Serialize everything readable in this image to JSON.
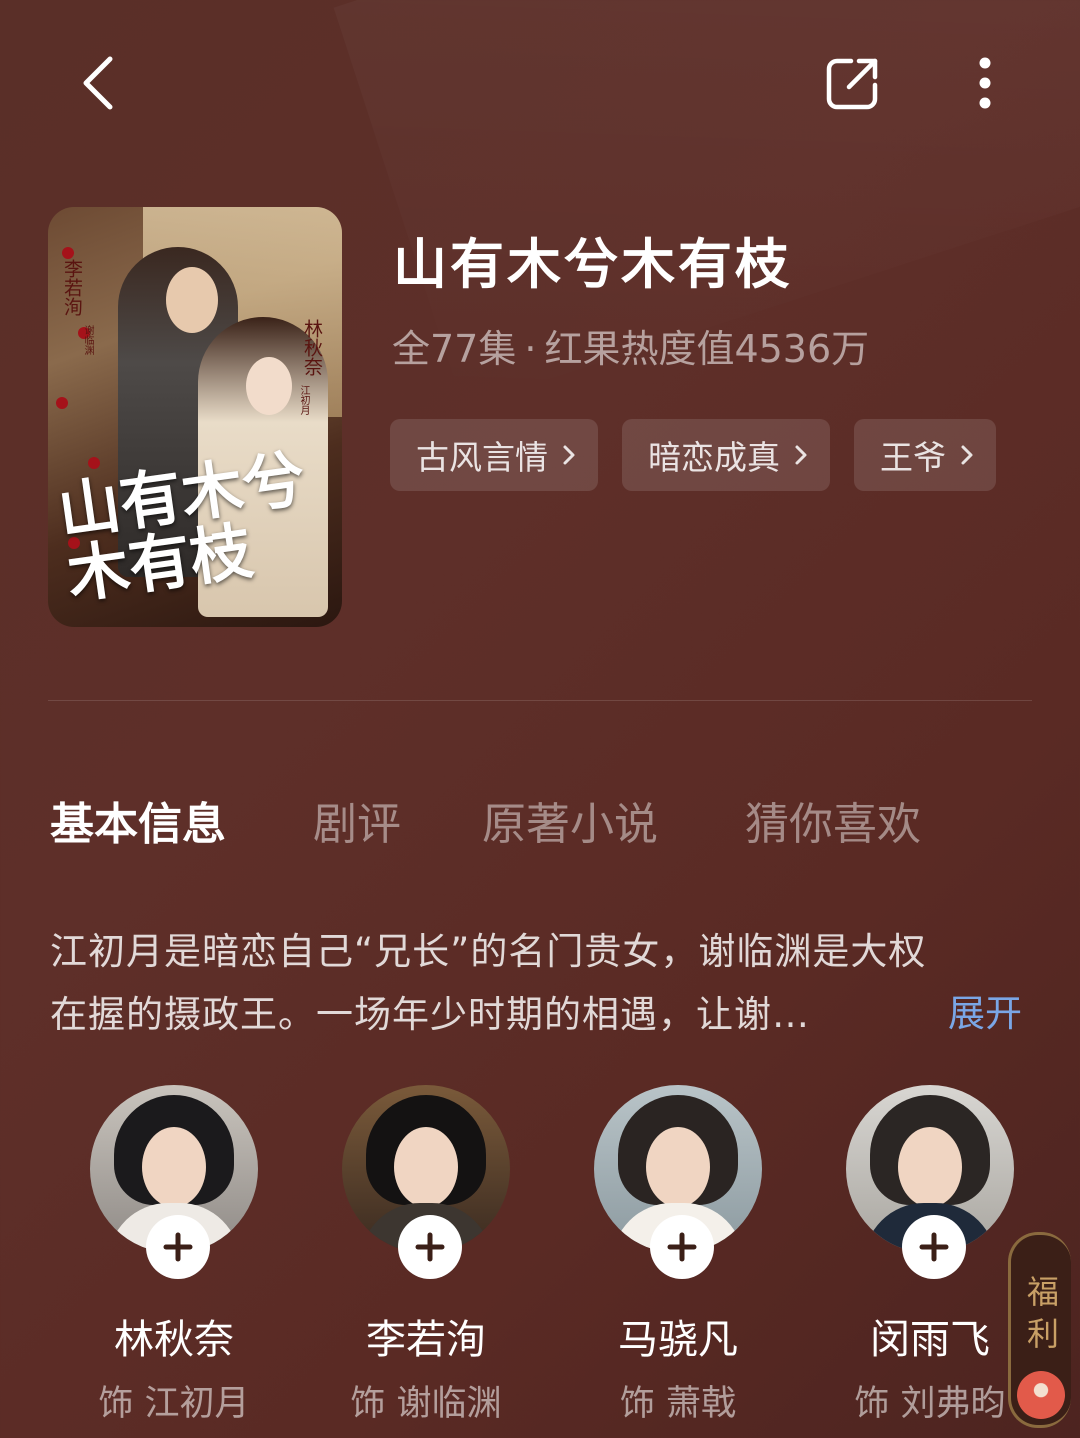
{
  "drama": {
    "title": "山有木兮木有枝",
    "episodes": "全77集",
    "separator": "·",
    "heat": "红果热度值4536万",
    "tags": [
      {
        "label": "古风言情"
      },
      {
        "label": "暗恋成真"
      },
      {
        "label": "王爷"
      }
    ],
    "poster": {
      "calligraphy": "山有木兮木有枝",
      "credit_left_name": "李若洵",
      "credit_left_role": "谢临渊",
      "credit_right_name": "林秋奈",
      "credit_right_role": "江初月"
    }
  },
  "tabs": [
    {
      "label": "基本信息",
      "active": true
    },
    {
      "label": "剧评",
      "active": false
    },
    {
      "label": "原著小说",
      "active": false
    },
    {
      "label": "猜你喜欢",
      "active": false
    }
  ],
  "synopsis": {
    "line1": "江初月是暗恋自己“兄长”的名门贵女，谢临渊是大权",
    "line2": "在握的摄政王。一场年少时期的相遇，让谢…",
    "expand_label": "展开"
  },
  "cast": [
    {
      "name": "林秋奈",
      "role": "饰 江初月"
    },
    {
      "name": "李若洵",
      "role": "饰 谢临渊"
    },
    {
      "name": "马骁凡",
      "role": "饰 萧戟"
    },
    {
      "name": "闵雨飞",
      "role": "饰 刘弗昀"
    }
  ],
  "welfare": {
    "label": "福利"
  },
  "colors": {
    "background": "#5a2f28",
    "expand_link": "#7aa6e6",
    "welfare_text": "#c9a066"
  },
  "icons": [
    "back-arrow-icon",
    "share-icon",
    "more-vertical-icon",
    "chevron-right-icon",
    "plus-icon"
  ]
}
